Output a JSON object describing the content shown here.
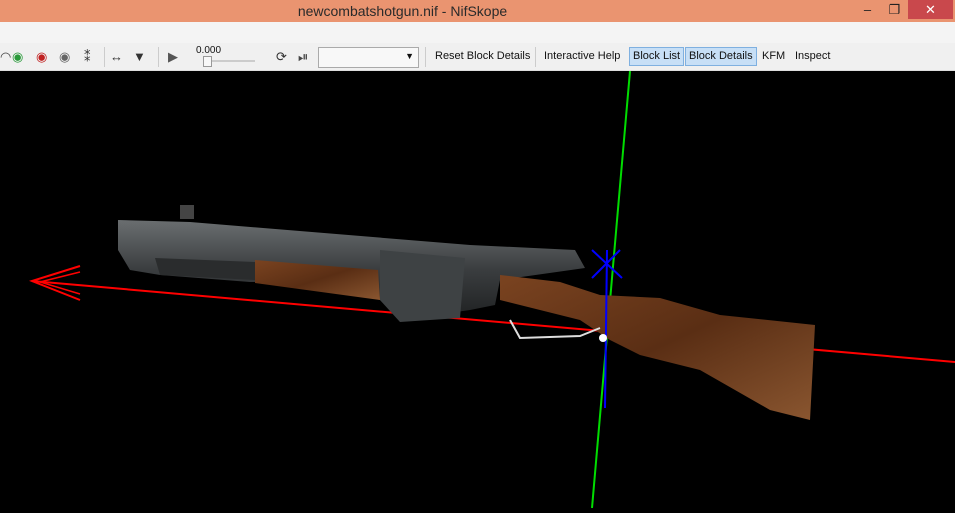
{
  "window": {
    "title": "newcombatshotgun.nif - NifSkope",
    "minimize": "–",
    "restore": "❐",
    "close": "✕",
    "close_color": "#c9484c",
    "titlebar_color": "#ea9470"
  },
  "toolbar": {
    "icons": [
      "view-icon",
      "eye-green-icon",
      "eye-red-icon",
      "eye-grey-icon",
      "footprints-icon",
      "move-icon",
      "cone-icon",
      "play-icon",
      "loop-icon",
      "step-icon"
    ],
    "time_value": "0.000",
    "slider_value": 0,
    "animation_select": "",
    "buttons": [
      {
        "label": "Reset Block Details",
        "active": false
      },
      {
        "label": "Interactive Help",
        "active": false
      },
      {
        "label": "Block List",
        "active": true
      },
      {
        "label": "Block Details",
        "active": true
      },
      {
        "label": "KFM",
        "active": false
      },
      {
        "label": "Inspect",
        "active": false
      }
    ]
  },
  "viewport": {
    "model": "newcombatshotgun",
    "axes": {
      "x": "#ff0000",
      "y": "#00dd00",
      "z": "#0000ff"
    }
  }
}
